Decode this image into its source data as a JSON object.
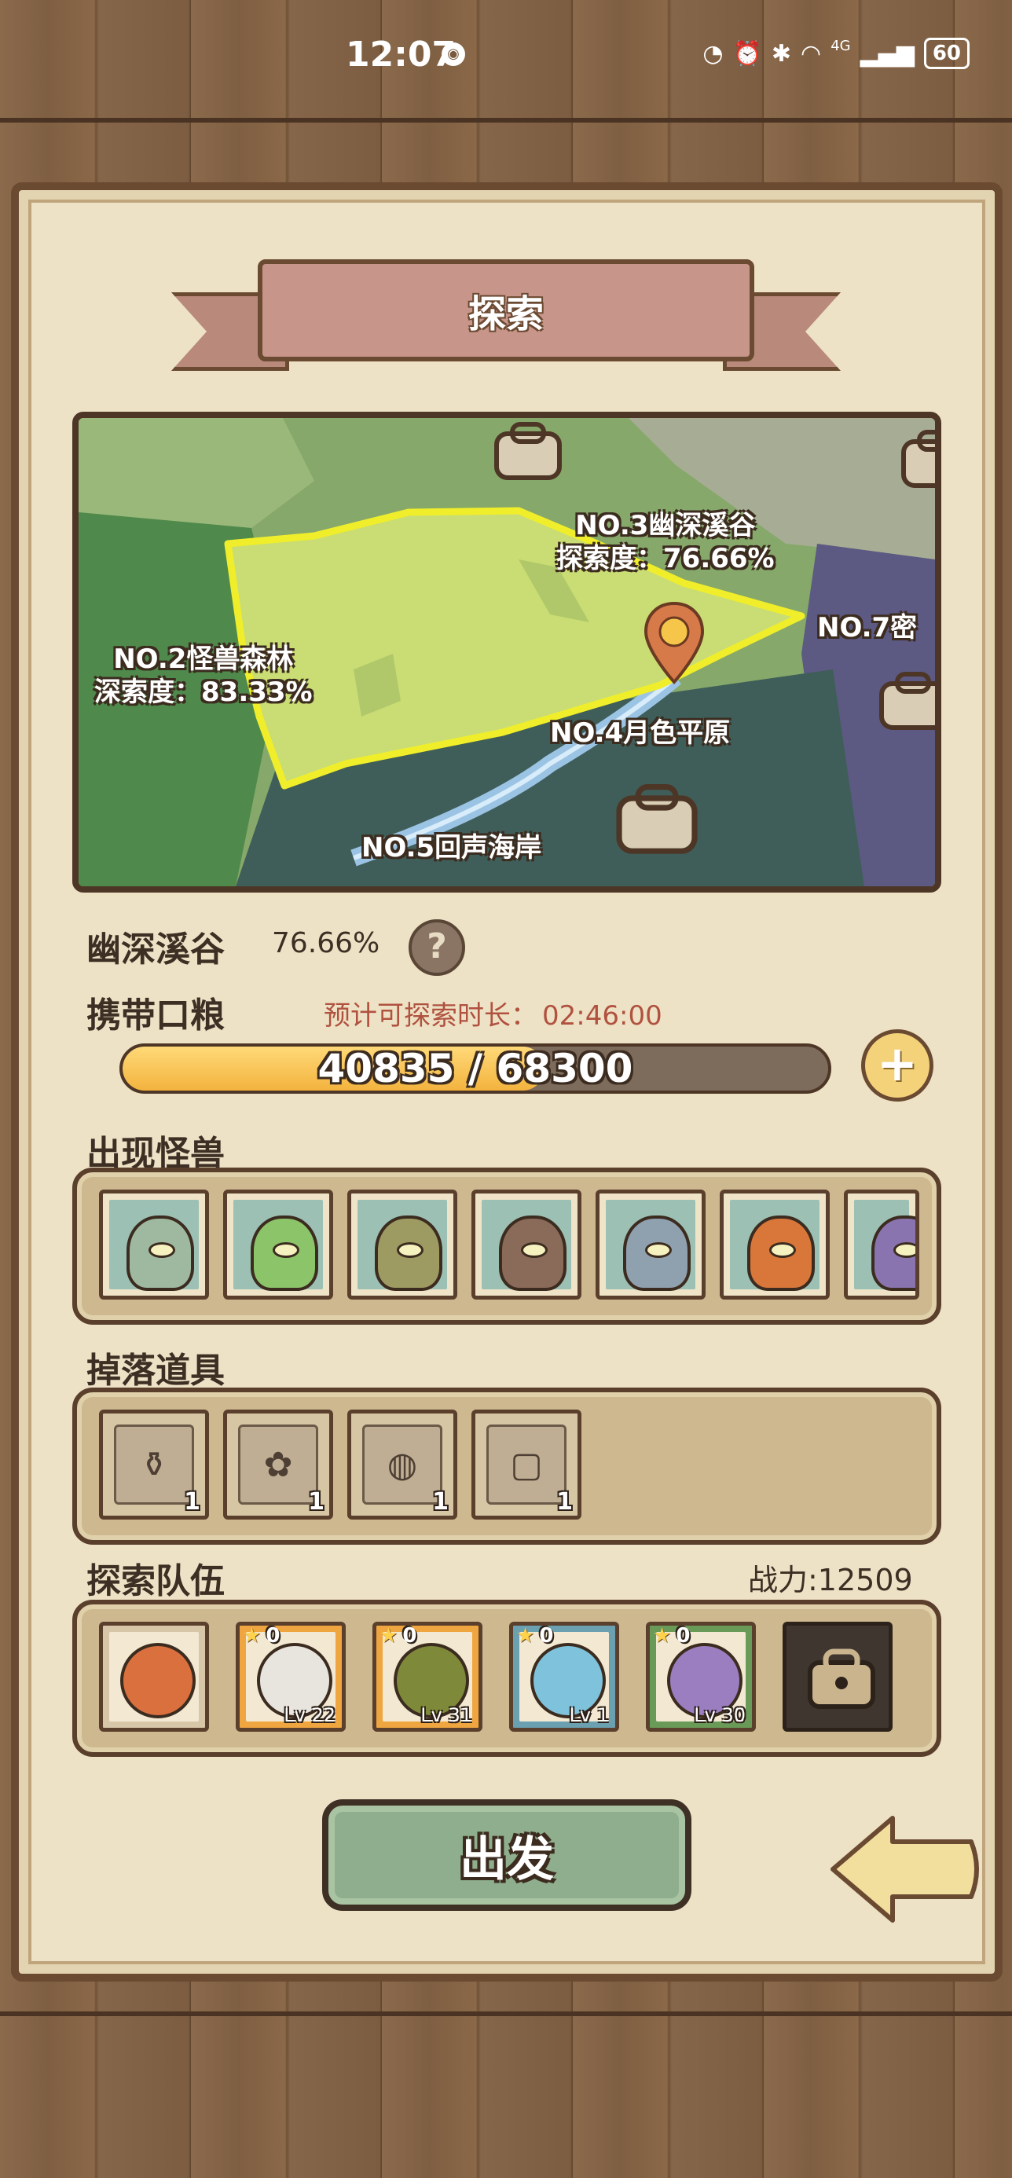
{
  "status_bar": {
    "time": "12:07",
    "network": "4G",
    "battery": "60"
  },
  "header": {
    "title": "探索"
  },
  "map": {
    "regions": [
      {
        "name": "NO.3幽深溪谷",
        "progress": "探索度：76.66%"
      },
      {
        "name": "NO.2怪兽森林",
        "progress": "深索度：83.33%"
      },
      {
        "name": "NO.7密"
      },
      {
        "name": "NO.4月色平原"
      },
      {
        "name": "NO.5回声海岸"
      }
    ]
  },
  "selected_region": {
    "name": "幽深溪谷",
    "progress": "76.66%"
  },
  "food": {
    "label": "携带口粮",
    "eta_label": "预计可探索时长：",
    "eta_time": "02:46:00",
    "current": 40835,
    "max": 68300,
    "text": "40835 / 68300"
  },
  "monsters": {
    "label": "出现怪兽",
    "items": [
      {
        "name": "robot-plant-monster-icon",
        "color": "#9fb8a0"
      },
      {
        "name": "green-sprout-monster-icon",
        "color": "#8cc46a"
      },
      {
        "name": "swamp-blob-monster-icon",
        "color": "#9d9a62"
      },
      {
        "name": "rock-golem-monster-icon",
        "color": "#8a6a58"
      },
      {
        "name": "stone-guardian-monster-icon",
        "color": "#8fa0ae"
      },
      {
        "name": "orange-sprout-monster-icon",
        "color": "#d9773a"
      },
      {
        "name": "crystal-eye-monster-icon",
        "color": "#8a74b0"
      }
    ]
  },
  "drops": {
    "label": "掉落道具",
    "items": [
      {
        "name": "potion-scroll-icon",
        "glyph": "⚱",
        "count": "1"
      },
      {
        "name": "pouch-scroll-icon",
        "glyph": "✿",
        "count": "1"
      },
      {
        "name": "cookie-scroll-icon",
        "glyph": "◍",
        "count": "1"
      },
      {
        "name": "sack-scroll-icon",
        "glyph": "▢",
        "count": "1"
      }
    ]
  },
  "team": {
    "label": "探索队伍",
    "power": "战力:12509",
    "members": [
      {
        "name": "leader-portrait",
        "frame": "#d8c6a8",
        "color": "#d9703e",
        "stars": "",
        "level": ""
      },
      {
        "name": "white-hair-hero",
        "frame": "#f0a640",
        "color": "#e8e4de",
        "stars": "0",
        "level": "Lv 22"
      },
      {
        "name": "green-hair-hero",
        "frame": "#f0a640",
        "color": "#7e8a3a",
        "stars": "0",
        "level": "Lv 31"
      },
      {
        "name": "blue-slime-hero",
        "frame": "#6aa0b0",
        "color": "#7fc2dc",
        "stars": "0",
        "level": "Lv 1"
      },
      {
        "name": "crystal-eye-hero",
        "frame": "#6a9a58",
        "color": "#9a7ec0",
        "stars": "0",
        "level": "Lv 30"
      }
    ]
  },
  "actions": {
    "go": "出发"
  },
  "colors": {
    "parchment": "#ede2c6",
    "border": "#6b4a32",
    "accent_green": "#8fae8d",
    "eta_red": "#b0523f"
  }
}
